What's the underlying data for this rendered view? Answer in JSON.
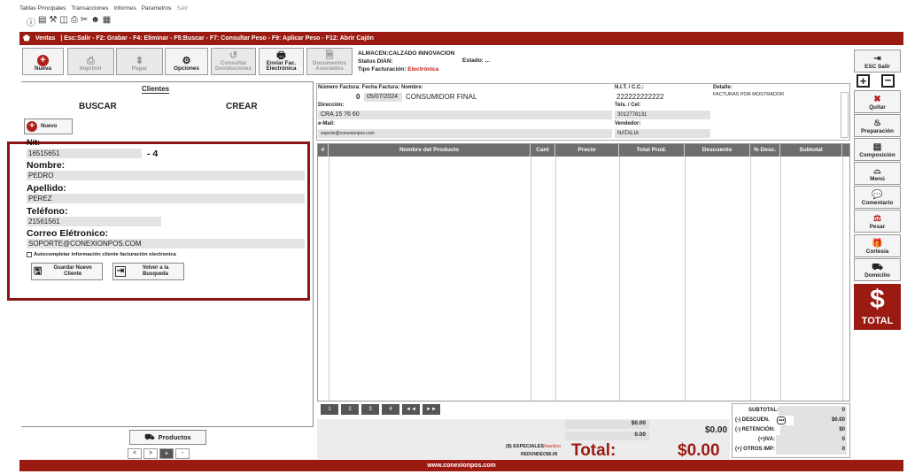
{
  "menu": [
    "Tablas Principales",
    "Transacciones",
    "Informes",
    "Parametros",
    "Salir"
  ],
  "titlebar": {
    "module": "Ventas",
    "shortcuts": "| Esc:Salir - F2: Grabar - F4: Eliminar - F5:Buscar - F7: Consultar Peso - F9: Aplicar Peso - F12: Abrir Cajón"
  },
  "toolbar": {
    "nueva": "Nueva",
    "imprimir": "Imprimir",
    "pagar": "Pagar",
    "opciones": "Opciones",
    "consultar_dev_1": "Consultar",
    "consultar_dev_2": "Devoluciones",
    "enviar_fac_1": "Enviar Fac.",
    "enviar_fac_2": "Electrónica",
    "documentos_1": "Documentos",
    "documentos_2": "Asociados"
  },
  "almacen": {
    "name": "ALMACEN:CALZADO INNOVACION",
    "status_label": "Status DIAN:",
    "estado_label": "Estado:",
    "estado_value": "...",
    "tipo_label": "Tipo Facturación:",
    "tipo_value": "Electrónica",
    "tipo_color": "#c0201a"
  },
  "cliente_panel": {
    "title": "Clientes",
    "buscar": "BUSCAR",
    "crear": "CREAR",
    "nuevo": "Nuevo",
    "nit_label": "Nit:",
    "nit_value": "16515651",
    "nit_dv": "- 4",
    "nombre_label": "Nombre:",
    "nombre_value": "PEDRO",
    "apellido_label": "Apellido:",
    "apellido_value": "PEREZ",
    "telefono_label": "Teléfono:",
    "telefono_value": "21561561",
    "correo_label": "Correo Elétronico:",
    "correo_value": "SOPORTE@CONEXIONPOS.COM",
    "autocompletar": "Autocompletar información cliente facturación electronica",
    "guardar_1": "Guardar Nuevo",
    "guardar_2": "Cliente",
    "volver_1": "Volver a la",
    "volver_2": "Busqueda",
    "productos": "Productos",
    "nav": [
      "<",
      ">",
      "+",
      "-"
    ]
  },
  "factura": {
    "header": "Número Factura: Fecha Factura: Nombre:",
    "numero": "0",
    "fecha": "05/07/2024",
    "nombre": "CONSUMIDOR FINAL",
    "nit_label": "N.I.T. / C.C.:",
    "nit_value": "222222222222",
    "detalle_label": "Detalle:",
    "detalle_value": "FACTURAS POR MOSTRADOR",
    "direccion_label": "Dirección:",
    "direccion_value": "CRA 15 76 60",
    "tels_label": "Tels. / Cel:",
    "tels_value": "3012778131",
    "email_label": "e-Mail:",
    "email_value": "soporte@conexionpos.com",
    "vendedor_label": "Vendedor:",
    "vendedor_value": "NATALIA"
  },
  "grid_columns": [
    "#",
    "Nombre del Producto",
    "Cant",
    "Precio",
    "Total Prod.",
    "Descuento",
    "% Desc.",
    "Subtotal"
  ],
  "pager": [
    "1",
    "2",
    "3",
    "4",
    "◄◄",
    "►►"
  ],
  "totals": {
    "val1": "$0.00",
    "val2": "0.00",
    "val3": "$0.00",
    "especiales_label": "($) ESPECIALES",
    "especiales_state": "Inactivo",
    "redondeo": "REDONDEO$0.00",
    "total_label": "Total:",
    "total_value": "$0.00",
    "subtotal_label": "SUBTOTAL:",
    "subtotal_value": "0",
    "descuento_label": "(-) DESCUEN.",
    "descuento_value": "$0.00",
    "retencion_label": "(-) RETENCIÓN:",
    "retencion_value": "$0",
    "iva_label": "(+)IVA:",
    "iva_value": "0",
    "otros_label": "(+) OTROS IMP:",
    "otros_value": "0"
  },
  "sidebar": {
    "esc_salir_1": "ESC",
    "esc_salir_2": "Salir",
    "quitar": "Quitar",
    "preparacion": "Preparación",
    "composicion": "Composición",
    "menu": "Menú",
    "comentario": "Comentario",
    "pesar": "Pesar",
    "cortesia": "Cortesia",
    "domicilio": "Domicilio",
    "total": "TOTAL"
  },
  "footer": "www.conexionpos.com",
  "colors": {
    "brand": "#9b1a12",
    "highlight_border": "#8c1515"
  }
}
